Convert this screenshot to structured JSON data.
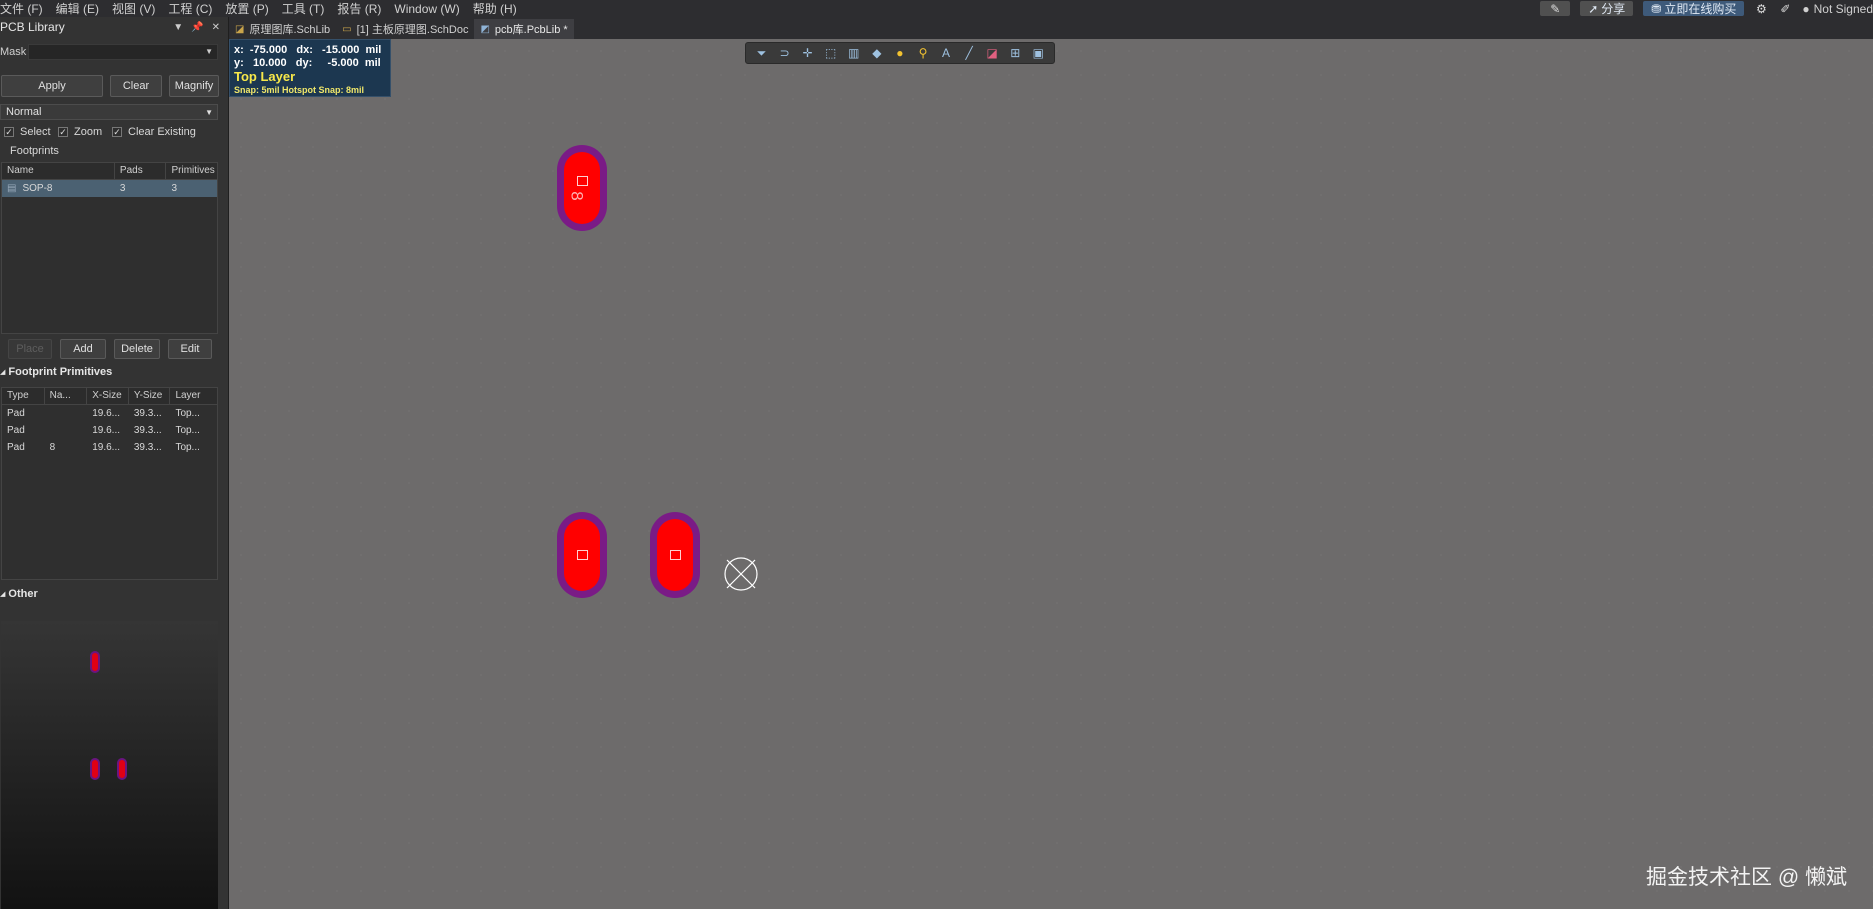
{
  "menu": [
    "文件 (F)",
    "编辑 (E)",
    "视图 (V)",
    "工程 (C)",
    "放置 (P)",
    "工具 (T)",
    "报告 (R)",
    "Window (W)",
    "帮助 (H)"
  ],
  "menubar_right": {
    "share": "分享",
    "buy": "立即在线购买",
    "user": "Not Signed"
  },
  "panel": {
    "title": "PCB Library",
    "mask_label": "Mask",
    "apply": "Apply",
    "clear": "Clear",
    "magnify": "Magnify",
    "mode": "Normal",
    "checks": {
      "select": "Select",
      "zoom": "Zoom",
      "clear_existing": "Clear Existing"
    },
    "footprints_title": "Footprints",
    "footprint_columns": [
      "Name",
      "Pads",
      "Primitives"
    ],
    "footprints": [
      {
        "name": "SOP-8",
        "pads": "3",
        "primitives": "3"
      }
    ],
    "buttons": {
      "place": "Place",
      "add": "Add",
      "delete": "Delete",
      "edit": "Edit"
    },
    "primitives_title": "Footprint Primitives",
    "primitive_columns": [
      "Type",
      "Na...",
      "X-Size",
      "Y-Size",
      "Layer"
    ],
    "primitives": [
      {
        "type": "Pad",
        "name": "",
        "xsize": "19.6...",
        "ysize": "39.3...",
        "layer": "Top..."
      },
      {
        "type": "Pad",
        "name": "",
        "xsize": "19.6...",
        "ysize": "39.3...",
        "layer": "Top..."
      },
      {
        "type": "Pad",
        "name": "8",
        "xsize": "19.6...",
        "ysize": "39.3...",
        "layer": "Top..."
      }
    ],
    "other_title": "Other"
  },
  "tabs": [
    {
      "label": "原理图库.SchLib",
      "active": false
    },
    {
      "label": "[1] 主板原理图.SchDoc",
      "active": false
    },
    {
      "label": "pcb库.PcbLib *",
      "active": true
    }
  ],
  "hud": {
    "line1": "x:  -75.000   dx:   -15.000  mil",
    "line2": "y:   10.000   dy:     -5.000  mil",
    "layer": "Top Layer",
    "snap": "Snap: 5mil Hotspot Snap: 8mil"
  },
  "canvas": {
    "pad_label": "8",
    "watermark": "掘金技术社区 @ 懒斌"
  },
  "colors": {
    "pad_copper": "#ff0000",
    "pad_mask": "#7a1b86",
    "canvas": "#6d6b6b",
    "hud_bg": "#1c3750",
    "layer_text": "#f7e84a"
  }
}
